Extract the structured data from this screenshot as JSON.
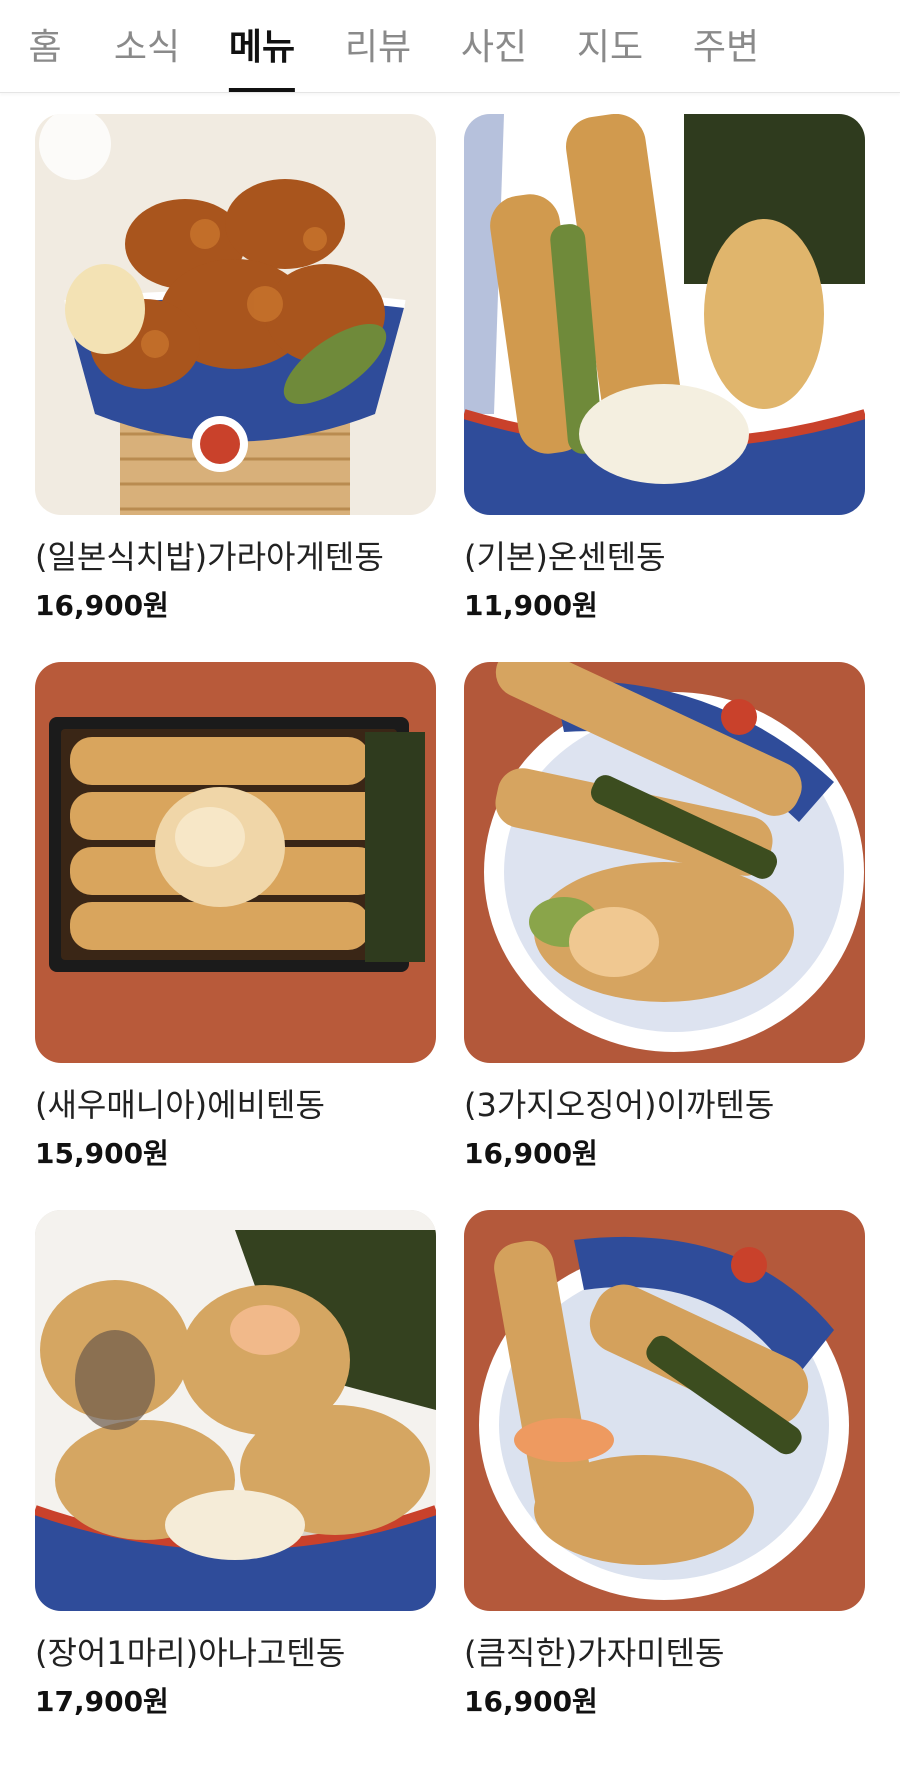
{
  "tabs": [
    {
      "label": "홈"
    },
    {
      "label": "소식"
    },
    {
      "label": "메뉴"
    },
    {
      "label": "리뷰"
    },
    {
      "label": "사진"
    },
    {
      "label": "지도"
    },
    {
      "label": "주변"
    }
  ],
  "active_tab": "메뉴",
  "menu_items": [
    {
      "name": "(일본식치밥)가라아게텐동",
      "price": "16,900원",
      "photo_icon": "karaage-tendon-photo",
      "background_color": "#f1ebe1"
    },
    {
      "name": "(기본)온센텐동",
      "price": "11,900원",
      "photo_icon": "onsen-tendon-photo",
      "background_color": "#e9e7e3"
    },
    {
      "name": "(새우매니아)에비텐동",
      "price": "15,900원",
      "photo_icon": "ebi-tendon-photo",
      "background_color": "#b85a3a"
    },
    {
      "name": "(3가지오징어)이까텐동",
      "price": "16,900원",
      "photo_icon": "ika-tendon-photo",
      "background_color": "#b3583a"
    },
    {
      "name": "(장어1마리)아나고텐동",
      "price": "17,900원",
      "photo_icon": "anago-tendon-photo",
      "background_color": "#d8d3ca"
    },
    {
      "name": "(큼직한)가자미텐동",
      "price": "16,900원",
      "photo_icon": "flatfish-tendon-photo",
      "background_color": "#b4593b"
    }
  ]
}
